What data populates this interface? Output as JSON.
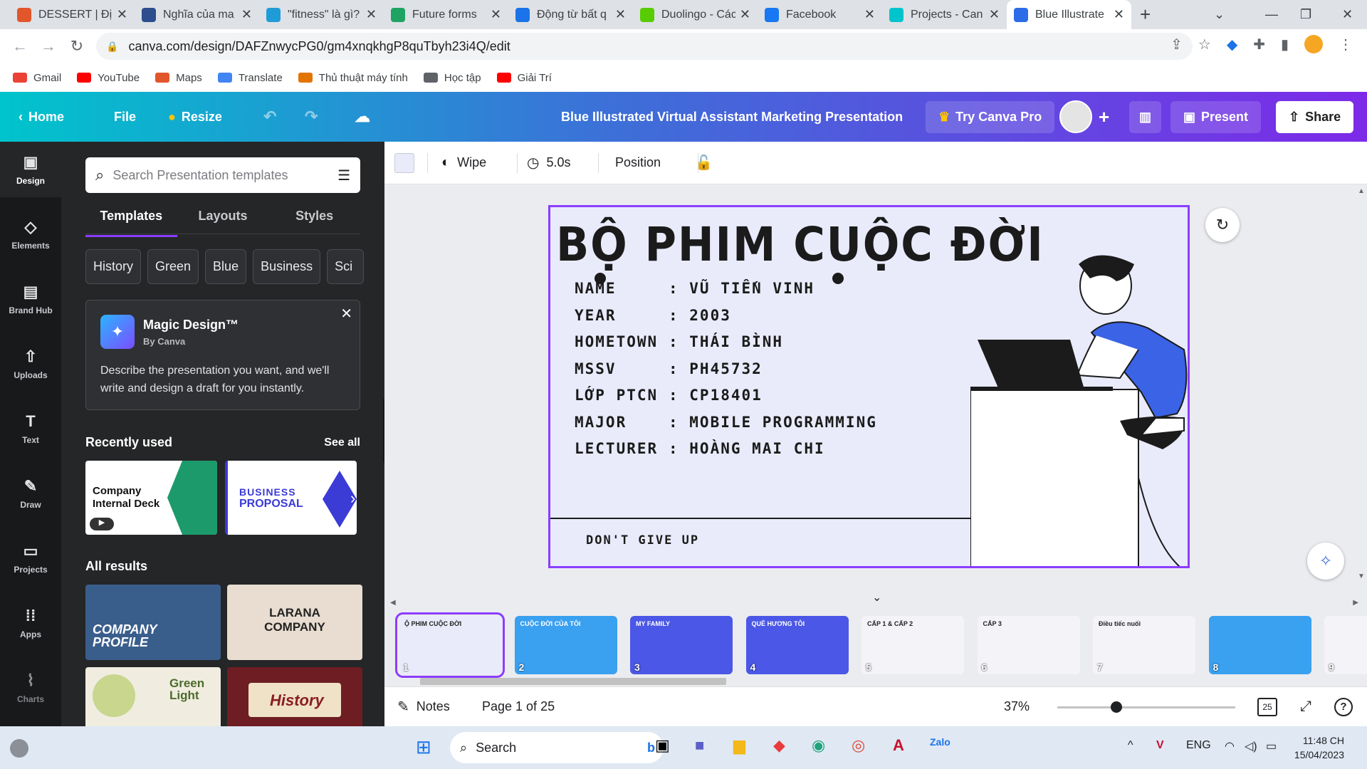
{
  "browser": {
    "tabs": [
      {
        "label": "DESSERT | Định",
        "color": "#e2562b"
      },
      {
        "label": "Nghĩa của ma",
        "color": "#2c4d8e"
      },
      {
        "label": "\"fitness\" là gì?",
        "color": "#1f9cd8"
      },
      {
        "label": "Future forms",
        "color": "#1ea362"
      },
      {
        "label": "Động từ bất q",
        "color": "#1a73e8"
      },
      {
        "label": "Duolingo - Các",
        "color": "#58cc02"
      },
      {
        "label": "Facebook",
        "color": "#1877f2"
      },
      {
        "label": "Projects - Can",
        "color": "#00c4cc"
      },
      {
        "label": "Blue Illustrate",
        "color": "#2c6ce8"
      }
    ],
    "url": "canva.com/design/DAFZnwycPG0/gm4xnqkhgP8quTbyh23i4Q/edit",
    "bookmarks": [
      "Gmail",
      "YouTube",
      "Maps",
      "Translate",
      "Thủ thuật máy tính",
      "Học tập",
      "Giải Trí"
    ]
  },
  "header": {
    "home": "Home",
    "file": "File",
    "resize": "Resize",
    "title": "Blue Illustrated Virtual Assistant Marketing Presentation",
    "try_pro": "Try Canva Pro",
    "present": "Present",
    "share": "Share"
  },
  "rail": [
    "Design",
    "Elements",
    "Brand Hub",
    "Uploads",
    "Text",
    "Draw",
    "Projects",
    "Apps",
    "Charts"
  ],
  "panel": {
    "search_placeholder": "Search Presentation templates",
    "tabs": [
      "Templates",
      "Layouts",
      "Styles"
    ],
    "chips": [
      "History",
      "Green",
      "Blue",
      "Business",
      "Sci"
    ],
    "magic": {
      "title": "Magic Design™",
      "by": "By Canva",
      "desc": "Describe the presentation you want, and we'll write and design a draft for you instantly."
    },
    "recent_h": "Recently used",
    "see_all": "See all",
    "recent": [
      {
        "line1": "Company",
        "line2": "Internal Deck"
      },
      {
        "line1": "BUSINESS",
        "line2": "PROPOSAL"
      }
    ],
    "all_h": "All results",
    "results": [
      "COMPANY PROFILE",
      "LARANA COMPANY",
      "Green Light",
      "History"
    ]
  },
  "toolbar": {
    "transition": "Wipe",
    "duration": "5.0s",
    "position": "Position"
  },
  "slide": {
    "title": "BỘ PHIM CUỘC ĐỜI",
    "rows": [
      {
        "k": "NAME",
        "v": ": VŨ TIẾN VINH"
      },
      {
        "k": "YEAR",
        "v": ": 2003"
      },
      {
        "k": "HOMETOWN",
        "v": ": THÁI BÌNH"
      },
      {
        "k": "MSSV",
        "v": ": PH45732"
      },
      {
        "k": "LỚP PTCN",
        "v": ": CP18401"
      },
      {
        "k": "MAJOR",
        "v": ": MOBILE PROGRAMMING"
      },
      {
        "k": "LECTURER",
        "v": ": HOÀNG MAI CHI"
      }
    ],
    "motto": "DON'T GIVE UP"
  },
  "pages": [
    {
      "n": "1",
      "bg": "#e9ebfb",
      "label": "Ộ PHIM CUỘC ĐỜI"
    },
    {
      "n": "2",
      "bg": "#3aa0f0",
      "label": "CUỘC ĐỜI CỦA TÔI"
    },
    {
      "n": "3",
      "bg": "#4b57e6",
      "label": "MY FAMILY"
    },
    {
      "n": "4",
      "bg": "#4b57e6",
      "label": "QUÊ HƯƠNG TÔI"
    },
    {
      "n": "5",
      "bg": "#f4f4f8",
      "label": "CẤP 1 & CẤP 2"
    },
    {
      "n": "6",
      "bg": "#f4f4f8",
      "label": "CẤP 3"
    },
    {
      "n": "7",
      "bg": "#f4f4f8",
      "label": "Điều tiếc nuối"
    },
    {
      "n": "8",
      "bg": "#3aa0f0",
      "label": ""
    },
    {
      "n": "9",
      "bg": "#f4f4f8",
      "label": ""
    }
  ],
  "footer": {
    "notes": "Notes",
    "page": "Page 1 of 25",
    "zoom": "37%",
    "zoom_level": 0.37,
    "grid_count": "25"
  },
  "taskbar": {
    "search": "Search",
    "lang": "ENG",
    "time": "11:48 CH",
    "date": "15/04/2023"
  }
}
